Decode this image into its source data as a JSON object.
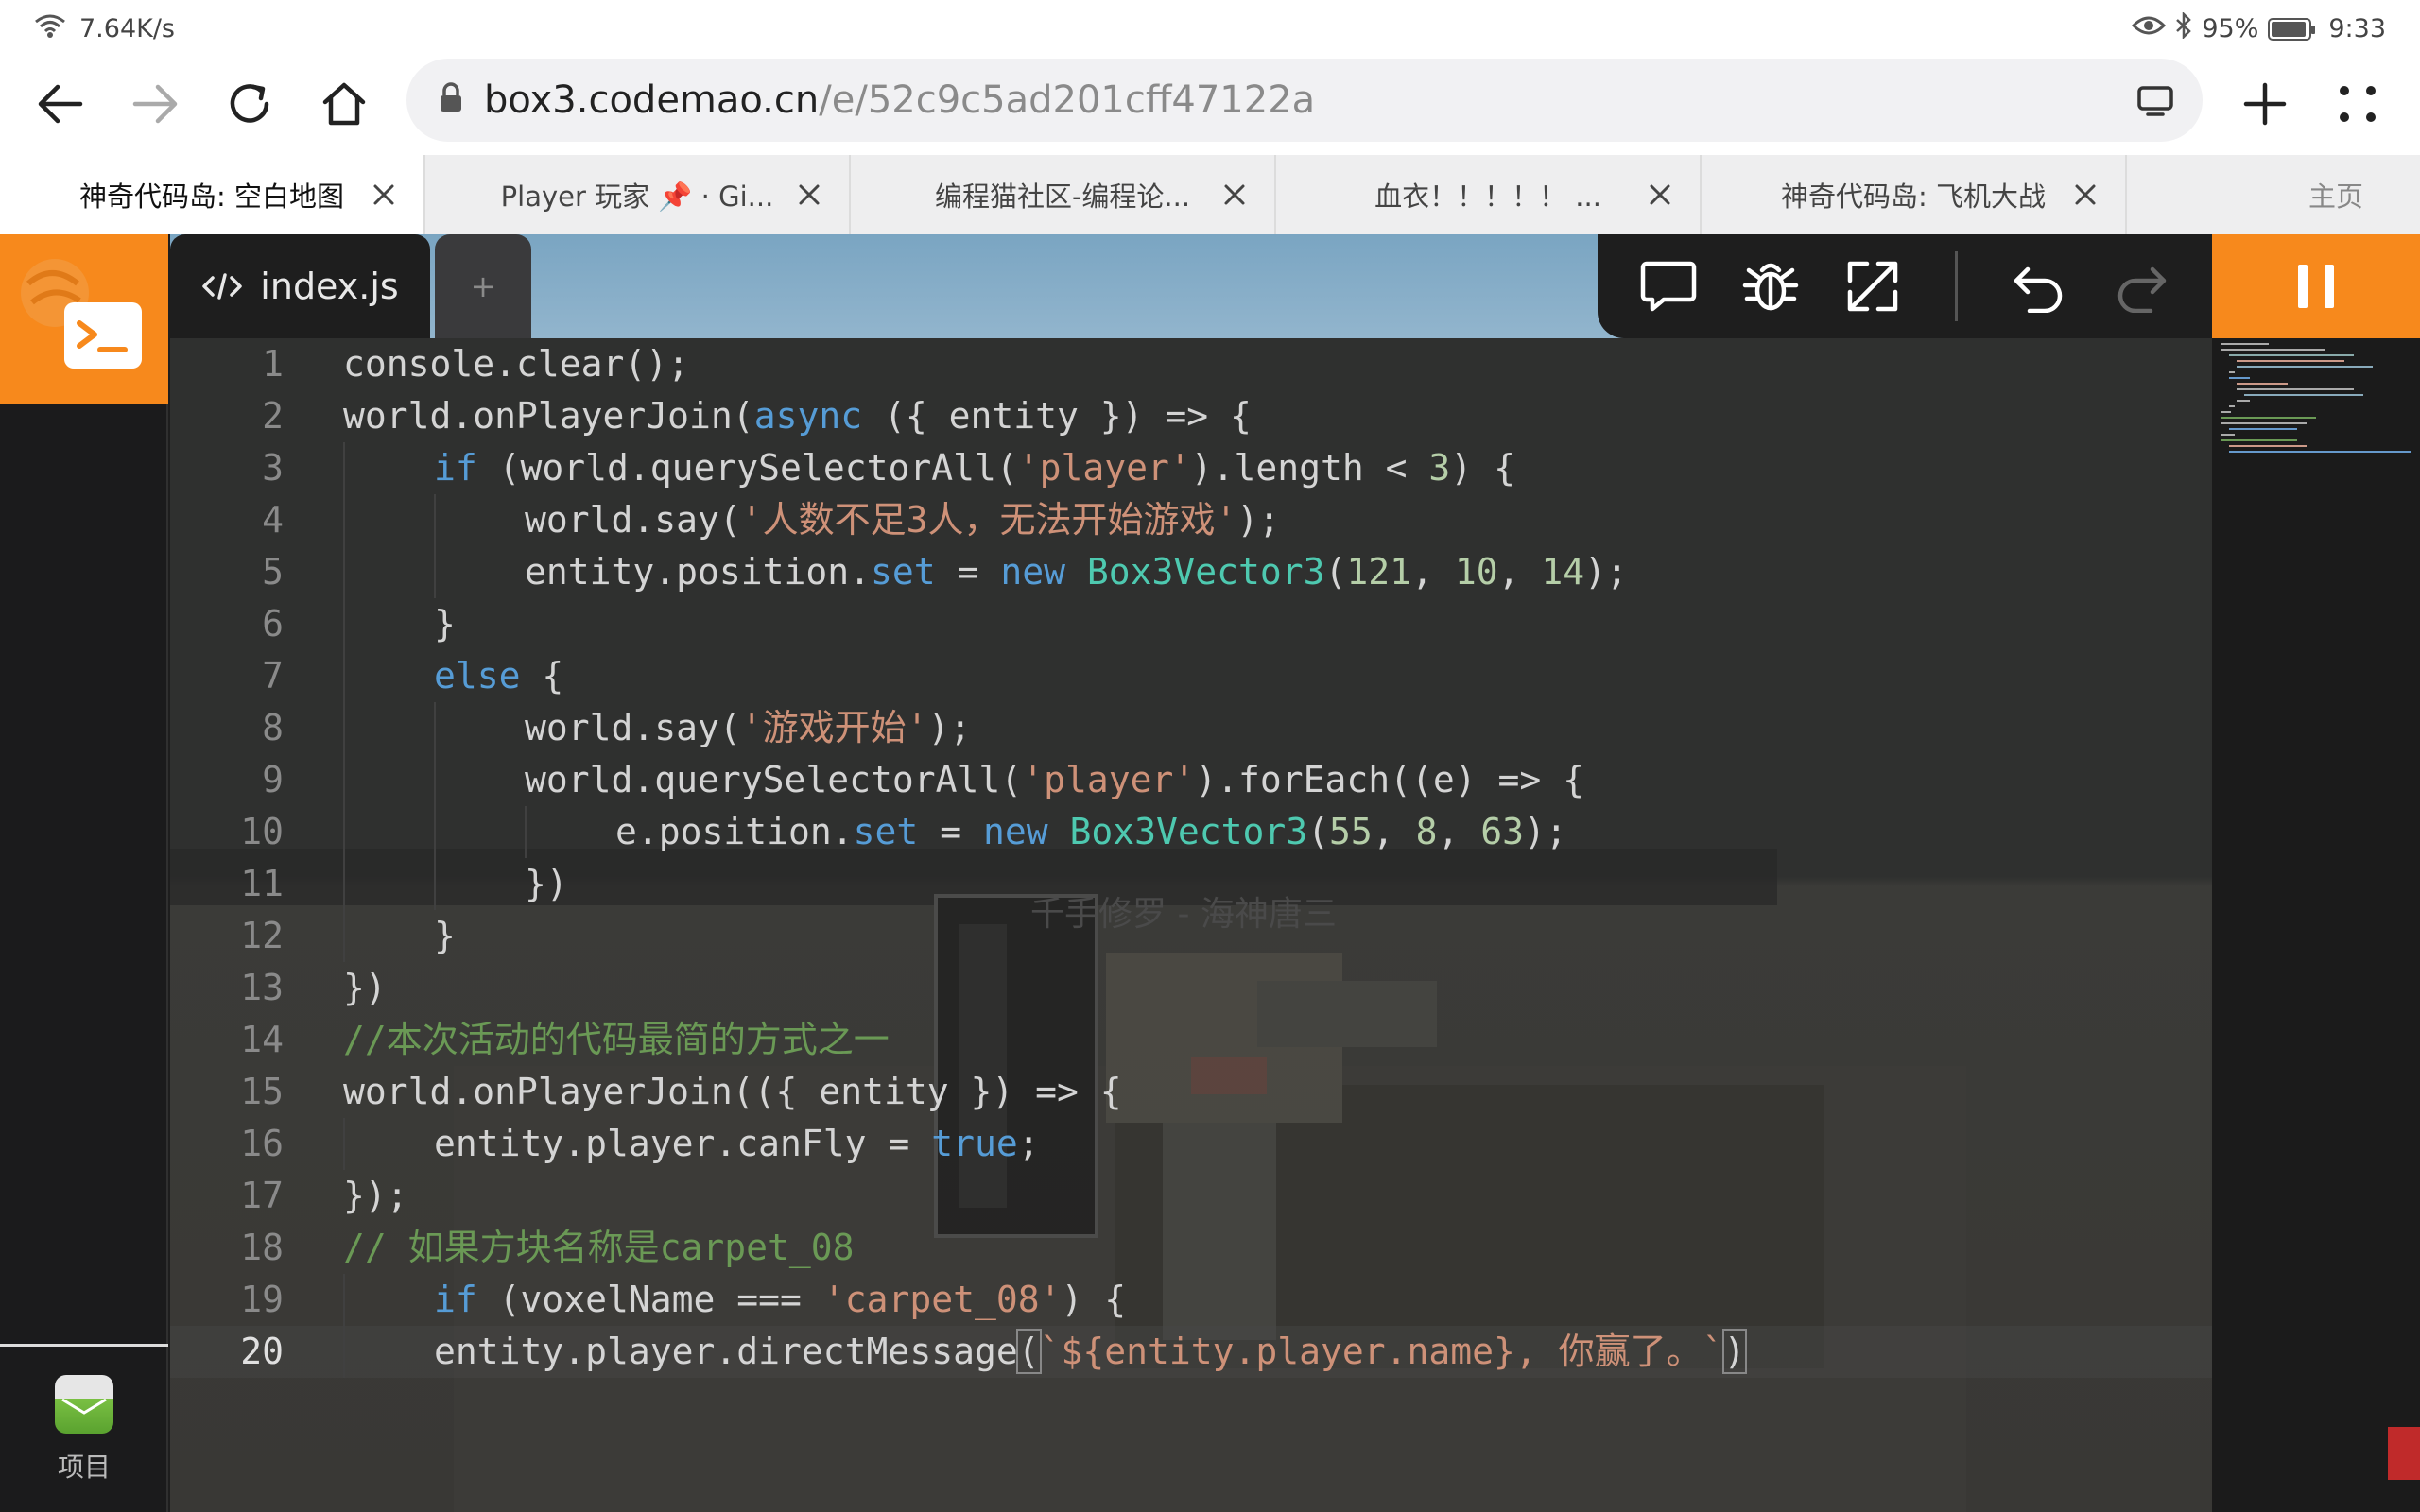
{
  "status_bar": {
    "net_speed": "7.64K/s",
    "battery_pct": "95%",
    "battery_level": 0.95,
    "time": "9:33"
  },
  "address_bar": {
    "url_host": "box3.codemao.cn",
    "url_path": "/e/52c9c5ad201cff47122a"
  },
  "tabs": [
    {
      "label": "神奇代码岛: 空白地图",
      "active": true
    },
    {
      "label": "Player 玩家 📌 · Gi...",
      "active": false
    },
    {
      "label": "编程猫社区-编程论...",
      "active": false
    },
    {
      "label": "血衣！！！！！ ...",
      "active": false
    },
    {
      "label": "神奇代码岛: 飞机大战",
      "active": false
    }
  ],
  "home_label": "主页",
  "editor": {
    "file_tab": "index.js",
    "add_tab": "+",
    "project_label": "项目",
    "current_line": 20,
    "scene_text": "千手修罗 - 海神唐三"
  },
  "code_lines": [
    {
      "n": "1",
      "indent": 0,
      "html": "console.clear();"
    },
    {
      "n": "2",
      "indent": 0,
      "html": "world.onPlayerJoin(<span class=\"kw\">async</span> ({ entity }) => {"
    },
    {
      "n": "3",
      "indent": 1,
      "html": "<span class=\"kw\">if</span> (world.querySelectorAll(<span class=\"str\">'player'</span>).length &lt; <span class=\"num\">3</span>) {"
    },
    {
      "n": "4",
      "indent": 2,
      "html": "world.say(<span class=\"str\">'人数不足3人，无法开始游戏'</span>);"
    },
    {
      "n": "5",
      "indent": 2,
      "html": "entity.position.<span class=\"kw\">set</span> = <span class=\"kw\">new</span> <span class=\"cls\">Box3Vector3</span>(<span class=\"num\">121</span>, <span class=\"num\">10</span>, <span class=\"num\">14</span>);"
    },
    {
      "n": "6",
      "indent": 1,
      "html": "}"
    },
    {
      "n": "7",
      "indent": 1,
      "html": "<span class=\"kw\">else</span> {"
    },
    {
      "n": "8",
      "indent": 2,
      "html": "world.say(<span class=\"str\">'游戏开始'</span>);"
    },
    {
      "n": "9",
      "indent": 2,
      "html": "world.querySelectorAll(<span class=\"str\">'player'</span>).forEach((e) => {"
    },
    {
      "n": "10",
      "indent": 3,
      "html": "e.position.<span class=\"kw\">set</span> = <span class=\"kw\">new</span> <span class=\"cls\">Box3Vector3</span>(<span class=\"num\">55</span>, <span class=\"num\">8</span>, <span class=\"num\">63</span>);"
    },
    {
      "n": "11",
      "indent": 2,
      "html": "})"
    },
    {
      "n": "12",
      "indent": 1,
      "html": "}"
    },
    {
      "n": "13",
      "indent": 0,
      "html": "})"
    },
    {
      "n": "14",
      "indent": 0,
      "html": "<span class=\"cm\">//本次活动的代码最简的方式之一</span>"
    },
    {
      "n": "15",
      "indent": 0,
      "html": "world.onPlayerJoin(({ entity }) => {"
    },
    {
      "n": "16",
      "indent": 1,
      "html": "entity.player.canFly = <span class=\"kw\">true</span>;"
    },
    {
      "n": "17",
      "indent": 0,
      "html": "});"
    },
    {
      "n": "18",
      "indent": 0,
      "html": "<span class=\"cm\">// 如果方块名称是carpet_08</span>"
    },
    {
      "n": "19",
      "indent": 1,
      "html": "<span class=\"kw\">if</span> (voxelName === <span class=\"str\">'carpet_08'</span>) {"
    },
    {
      "n": "20",
      "indent": 1,
      "html": "entity.player.directMessage<span class=\"br\">(</span><span class=\"str\">`${entity.player.name}, 你赢了。`</span><span class=\"br\">)</span>"
    }
  ]
}
